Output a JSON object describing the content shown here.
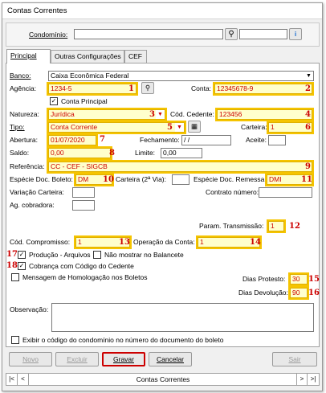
{
  "window": {
    "title": "Contas Correntes"
  },
  "header": {
    "condominio_label": "Condomínio:",
    "condominio_value": ""
  },
  "tabs": [
    {
      "label": "Principal"
    },
    {
      "label": "Outras Configurações"
    },
    {
      "label": "CEF"
    }
  ],
  "form": {
    "banco": {
      "label": "Banco:",
      "value": "Caixa Econômica Federal"
    },
    "agencia": {
      "label": "Agência:",
      "value": "1234-5",
      "marker": "1"
    },
    "conta": {
      "label": "Conta:",
      "value": "12345678-9",
      "marker": "2"
    },
    "conta_principal": {
      "label": "Conta Principal",
      "checked": true
    },
    "natureza": {
      "label": "Natureza:",
      "value": "Jurídica",
      "marker": "3"
    },
    "cod_cedente": {
      "label": "Cód. Cedente:",
      "value": "123456",
      "marker": "4"
    },
    "tipo": {
      "label": "Tipo:",
      "value": "Conta Corrente",
      "marker": "5"
    },
    "carteira": {
      "label": "Carteira:",
      "value": "1",
      "marker": "6"
    },
    "abertura": {
      "label": "Abertura:",
      "value": "01/07/2020",
      "marker": "7"
    },
    "fechamento": {
      "label": "Fechamento:",
      "value": "/ /"
    },
    "aceite": {
      "label": "Aceite:",
      "value": ""
    },
    "saldo": {
      "label": "Saldo:",
      "value": "0,00",
      "marker": "8"
    },
    "limite": {
      "label": "Limite:",
      "value": "0,00"
    },
    "referencia": {
      "label": "Referência:",
      "value": "CC - CEF - SIGCB",
      "marker": "9"
    },
    "especie_boleto": {
      "label": "Espécie Doc. Boleto:",
      "value": "DM",
      "marker": "10"
    },
    "carteira_2via": {
      "label": "Carteira (2ª Via):",
      "value": ""
    },
    "especie_remessa": {
      "label": "Espécie Doc. Remessa:",
      "value": "DMI",
      "marker": "11"
    },
    "variacao_carteira": {
      "label": "Variação Carteira:",
      "value": ""
    },
    "contrato_numero": {
      "label": "Contrato número:",
      "value": ""
    },
    "ag_cobradora": {
      "label": "Ag. cobradora:",
      "value": ""
    },
    "param_transmissao": {
      "label": "Param. Transmissão:",
      "value": "1",
      "marker": "12"
    },
    "cod_compromisso": {
      "label": "Cód. Compromisso:",
      "value": "1",
      "marker": "13"
    },
    "operacao_conta": {
      "label": "Operação da Conta:",
      "value": "1",
      "marker": "14"
    },
    "producao_arquivos": {
      "label": "Produção - Arquivos",
      "checked": true,
      "marker": "17"
    },
    "nao_mostrar_balancete": {
      "label": "Não mostrar no Balancete",
      "checked": false
    },
    "cobranca_codigo_cedente": {
      "label": "Cobrança com Código do Cedente",
      "checked": true,
      "marker": "18"
    },
    "mensagem_homologacao": {
      "label": "Mensagem de Homologação nos Boletos",
      "checked": false
    },
    "dias_protesto": {
      "label": "Dias Protesto:",
      "value": "30",
      "marker": "15"
    },
    "dias_devolucao": {
      "label": "Dias Devolução:",
      "value": "90",
      "marker": "16"
    },
    "observacao": {
      "label": "Observação:",
      "value": ""
    },
    "exibir_codigo": {
      "label": "Exibir o código do condomínio no número do documento do boleto",
      "checked": false
    }
  },
  "buttons": {
    "novo": "Novo",
    "excluir": "Excluir",
    "gravar": "Gravar",
    "cancelar": "Cancelar",
    "sair": "Sair"
  },
  "navigator": {
    "label": "Contas Correntes",
    "first": "|<",
    "prev": "<",
    "next": ">",
    "last": ">|"
  },
  "colors": {
    "highlight": "#f5c400",
    "marker": "#cc0000",
    "field_bg": "#ffffcc",
    "focus_button_border": "#cc0000"
  }
}
